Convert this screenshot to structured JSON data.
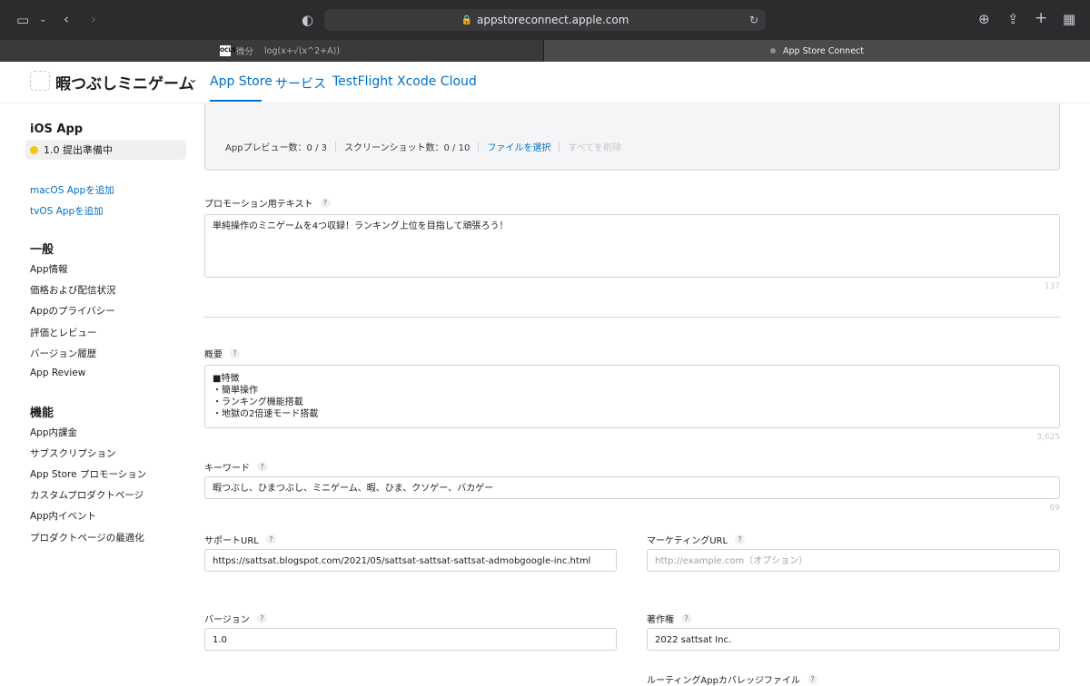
{
  "browser": {
    "url": "appstoreconnect.apple.com",
    "tabs": [
      {
        "favicon_text": "OCLS",
        "title_a": "微分",
        "title_b": "log(x+√(x^2+A))"
      },
      {
        "title": "App Store Connect"
      }
    ]
  },
  "header": {
    "app_name": "暇つぶしミニゲーム",
    "nav": [
      "App Store",
      "サービス",
      "TestFlight",
      "Xcode Cloud"
    ]
  },
  "sidebar": {
    "platform_title": "iOS App",
    "version_status": "1.0 提出準備中",
    "add_links": [
      "macOS Appを追加",
      "tvOS Appを追加"
    ],
    "general_title": "一般",
    "general_items": [
      "App情報",
      "価格および配信状況",
      "Appのプライバシー",
      "評価とレビュー",
      "バージョン履歴",
      "App Review"
    ],
    "features_title": "機能",
    "features_items": [
      "App内課金",
      "サブスクリプション",
      "App Store プロモーション",
      "カスタムプロダクトページ",
      "App内イベント",
      "プロダクトページの最適化"
    ]
  },
  "media": {
    "preview_count": "Appプレビュー数：0 / 3",
    "screenshot_count": "スクリーンショット数：0 / 10",
    "choose_file": "ファイルを選択",
    "delete_all": "すべてを削除"
  },
  "form": {
    "promo_label": "プロモーション用テキスト",
    "promo_text": "単純操作のミニゲームを4つ収録！ランキング上位を目指して頑張ろう！",
    "promo_count": "137",
    "desc_label": "概要",
    "desc_lines": [
      "■特徴",
      "・簡単操作",
      "・ランキング機能搭載",
      "・地獄の2倍速モード搭載"
    ],
    "desc_count": "3,625",
    "keywords_label": "キーワード",
    "keywords_value": "暇つぶし、ひまつぶし、ミニゲーム、暇、ひま、クソゲー、バカゲー",
    "keywords_count": "69",
    "support_url_label": "サポートURL",
    "support_url_value": "https://sattsat.blogspot.com/2021/05/sattsat-sattsat-sattsat-admobgoogle-inc.html",
    "marketing_url_label": "マーケティングURL",
    "marketing_url_placeholder": "http://example.com（オプション）",
    "version_label": "バージョン",
    "version_value": "1.0",
    "copyright_label": "著作権",
    "copyright_value": "2022 sattsat Inc.",
    "routing_label": "ルーティングAppカバレッジファイル",
    "help_mark": "?"
  },
  "colors": {
    "accent": "#0070c9",
    "status_dot": "#f5c518"
  }
}
